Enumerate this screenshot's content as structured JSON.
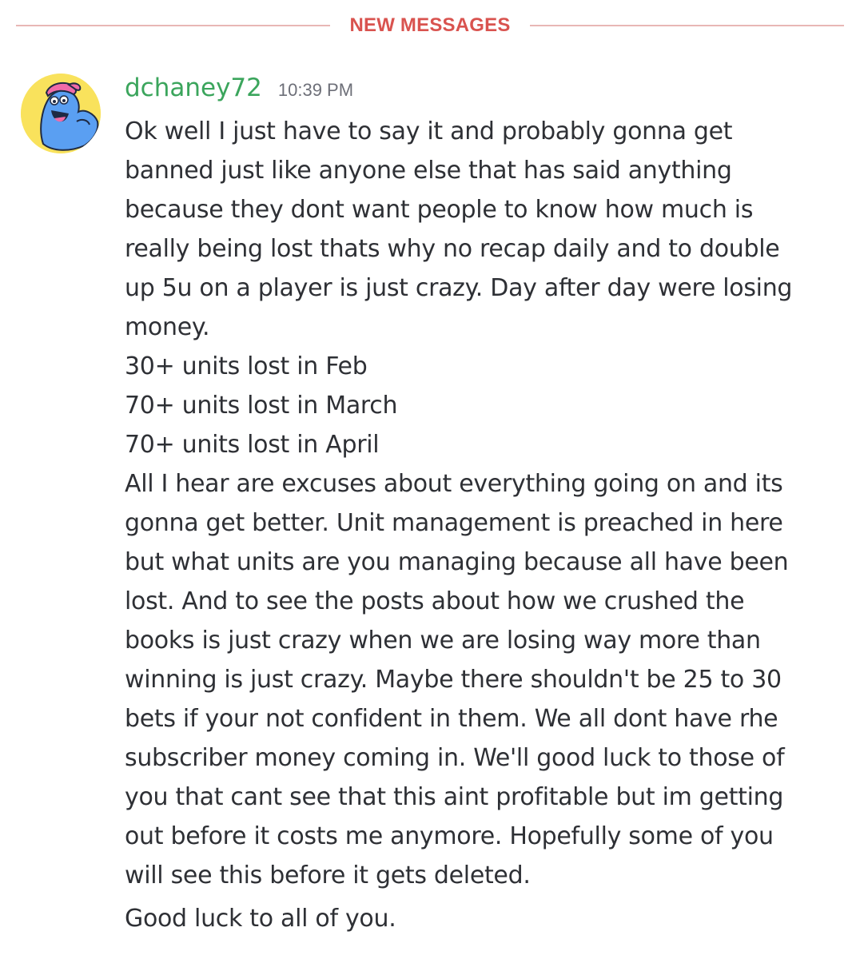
{
  "divider": {
    "label": "NEW MESSAGES",
    "color": "#d9534f"
  },
  "message": {
    "avatar_icon": "blue-creature-avatar-icon",
    "username": "dchaney72",
    "username_color": "#3ba55c",
    "timestamp": "10:39 PM",
    "lines": [
      "Ok well I just have to say it and probably gonna get",
      "banned just like anyone else that has said anything",
      "because they dont want people to know how much is",
      "really being lost thats why no recap daily and to double",
      "up 5u on a player is just crazy. Day after day were losing",
      "money.",
      "30+ units lost in Feb",
      "70+ units lost in March",
      "70+ units lost in April",
      "All I hear are excuses about everything going on and its",
      "gonna get better. Unit management is preached in here",
      "but what units are you managing because all have been",
      "lost. And to see the posts about how we crushed the",
      "books is just crazy when we are losing way more than",
      "winning is just crazy. Maybe there shouldn't be 25 to 30",
      "bets if your not confident in them. We all dont have rhe",
      "subscriber money coming in. We'll good luck to those of",
      "you that cant see that this aint profitable but im getting",
      "out before it costs me anymore. Hopefully some of you",
      "will see this before it gets deleted."
    ],
    "signoff": "Good luck to all of you."
  }
}
